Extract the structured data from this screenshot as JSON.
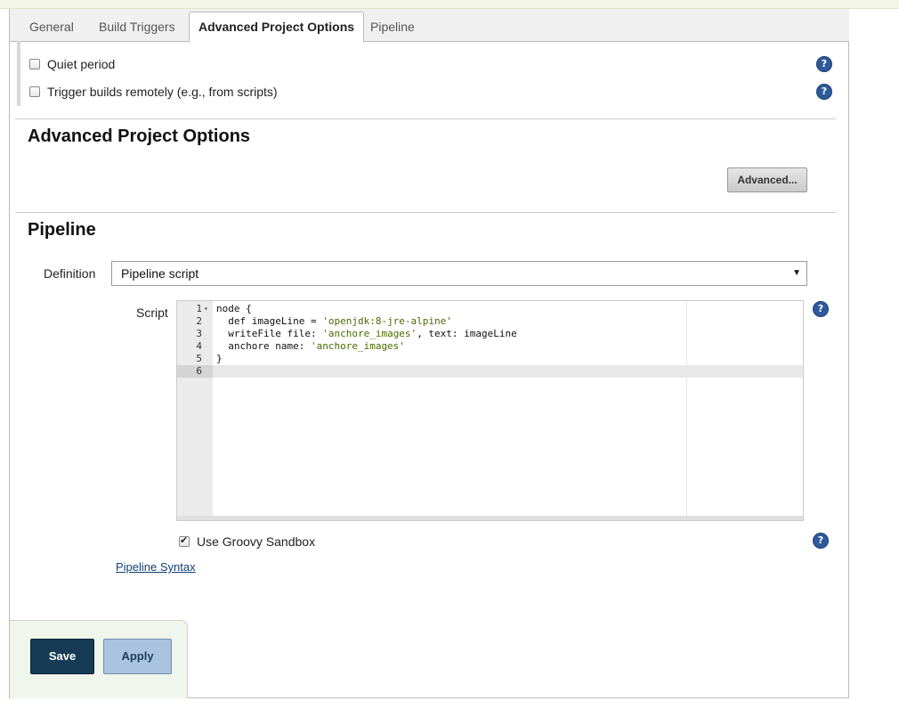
{
  "tabs": [
    {
      "label": "General"
    },
    {
      "label": "Build Triggers"
    },
    {
      "label": "Advanced Project Options"
    },
    {
      "label": "Pipeline"
    }
  ],
  "build_triggers": {
    "quiet_period_label": "Quiet period",
    "trigger_remote_label": "Trigger builds remotely (e.g., from scripts)"
  },
  "advanced_section": {
    "title": "Advanced Project Options",
    "advanced_button": "Advanced..."
  },
  "pipeline": {
    "title": "Pipeline",
    "definition_label": "Definition",
    "definition_value": "Pipeline script",
    "script_label": "Script",
    "script_lines": [
      {
        "num": "1",
        "text": "node {"
      },
      {
        "num": "2",
        "text": "  def imageLine = 'openjdk:8-jre-alpine'"
      },
      {
        "num": "3",
        "text": "  writeFile file: 'anchore_images', text: imageLine"
      },
      {
        "num": "4",
        "text": "  anchore name: 'anchore_images'"
      },
      {
        "num": "5",
        "text": "}"
      },
      {
        "num": "6",
        "text": ""
      }
    ],
    "sandbox_label": "Use Groovy Sandbox",
    "sandbox_checked": true,
    "syntax_link": "Pipeline Syntax"
  },
  "actions": {
    "save": "Save",
    "apply": "Apply"
  },
  "colors": {
    "save_bg": "#173b55",
    "apply_bg": "#a9c3e0",
    "help_icon": "#2e5a9c"
  }
}
